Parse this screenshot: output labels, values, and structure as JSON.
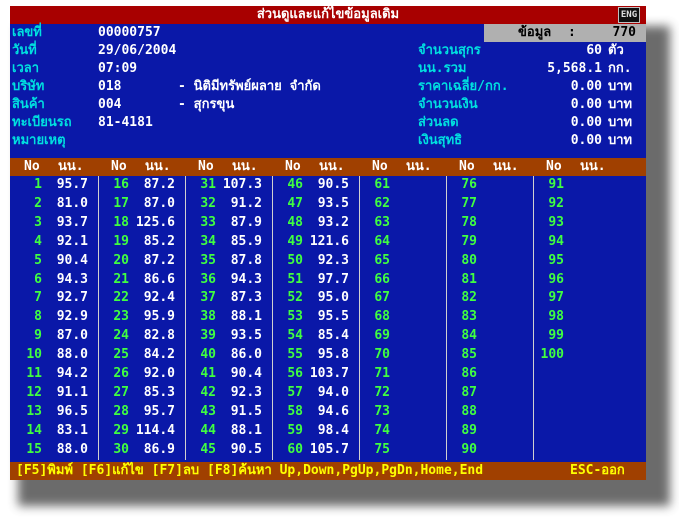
{
  "title": "ส่วนดูและแก้ไขข้อมูลเดิม",
  "eng_indicator": "ENG",
  "record": {
    "label": "ข้อมูล",
    "sep": ":",
    "value": "770"
  },
  "fields": [
    {
      "label": "เลขที่",
      "value": "00000757"
    },
    {
      "label": "วันที่",
      "value": "29/06/2004"
    },
    {
      "label": "เวลา",
      "value": "07:09"
    },
    {
      "label": "บริษัท",
      "value": "018",
      "extra": "- นิติมีทรัพย์ผลาย จำกัด"
    },
    {
      "label": "สินค้า",
      "value": "004",
      "extra": "- สุกรขุน"
    },
    {
      "label": "ทะเบียนรถ",
      "value": "81-4181"
    },
    {
      "label": "หมายเหตุ",
      "value": ""
    }
  ],
  "summary": [
    {
      "label": "จำนวนสุกร",
      "value": "60",
      "unit": "ตัว"
    },
    {
      "label": "นน.รวม",
      "value": "5,568.1",
      "unit": "กก."
    },
    {
      "label": "ราคาเฉลี่ย/กก.",
      "value": "0.00",
      "unit": "บาท"
    },
    {
      "label": "จำนวนเงิน",
      "value": "0.00",
      "unit": "บาท"
    },
    {
      "label": "ส่วนลด",
      "value": "0.00",
      "unit": "บาท"
    },
    {
      "label": "เงินสุทธิ",
      "value": "0.00",
      "unit": "บาท"
    }
  ],
  "columns": {
    "no": "No",
    "weight": "นน."
  },
  "weights": [
    "95.7",
    "81.0",
    "93.7",
    "92.1",
    "90.4",
    "94.3",
    "92.7",
    "92.9",
    "87.0",
    "88.0",
    "94.2",
    "91.1",
    "96.5",
    "83.1",
    "88.0",
    "87.2",
    "87.0",
    "125.6",
    "85.2",
    "87.2",
    "86.6",
    "92.4",
    "95.9",
    "82.8",
    "84.2",
    "92.0",
    "85.3",
    "95.7",
    "114.4",
    "86.9",
    "107.3",
    "91.2",
    "87.9",
    "85.9",
    "87.8",
    "94.3",
    "87.3",
    "88.1",
    "93.5",
    "86.0",
    "90.4",
    "92.3",
    "91.5",
    "88.1",
    "90.5",
    "90.5",
    "93.5",
    "93.2",
    "121.6",
    "92.3",
    "97.7",
    "95.0",
    "95.5",
    "85.4",
    "95.8",
    "103.7",
    "94.0",
    "94.6",
    "98.4",
    "105.7",
    "",
    "",
    "",
    "",
    "",
    "",
    "",
    "",
    "",
    "",
    "",
    "",
    "",
    "",
    "",
    "",
    "",
    "",
    "",
    "",
    "",
    "",
    "",
    "",
    "",
    "",
    "",
    "",
    "",
    "",
    "",
    "",
    "",
    "",
    "",
    "",
    "",
    "",
    "",
    "",
    "",
    "",
    "",
    "",
    ""
  ],
  "row_numbers": [
    "1",
    "2",
    "3",
    "4",
    "5",
    "6",
    "7",
    "8",
    "9",
    "10",
    "11",
    "12",
    "13",
    "14",
    "15",
    "16",
    "17",
    "18",
    "19",
    "20",
    "21",
    "22",
    "23",
    "24",
    "25",
    "26",
    "27",
    "28",
    "29",
    "30",
    "31",
    "32",
    "33",
    "34",
    "35",
    "36",
    "37",
    "38",
    "39",
    "40",
    "41",
    "42",
    "43",
    "44",
    "45",
    "46",
    "47",
    "48",
    "49",
    "50",
    "51",
    "52",
    "53",
    "54",
    "55",
    "56",
    "57",
    "58",
    "59",
    "60",
    "61",
    "62",
    "63",
    "64",
    "65",
    "66",
    "67",
    "68",
    "69",
    "70",
    "71",
    "72",
    "73",
    "74",
    "75",
    "76",
    "77",
    "78",
    "79",
    "80",
    "81",
    "82",
    "83",
    "84",
    "85",
    "86",
    "87",
    "88",
    "89",
    "90",
    "91",
    "92",
    "93",
    "94",
    "95",
    "96",
    "97",
    "98",
    "99",
    "100"
  ],
  "footer": {
    "keys": "[F5]พิมพ์ [F6]แก้ไข [F7]ลบ [F8]ค้นหา Up,Down,PgUp,PgDn,Home,End",
    "exit": "ESC-ออก"
  }
}
